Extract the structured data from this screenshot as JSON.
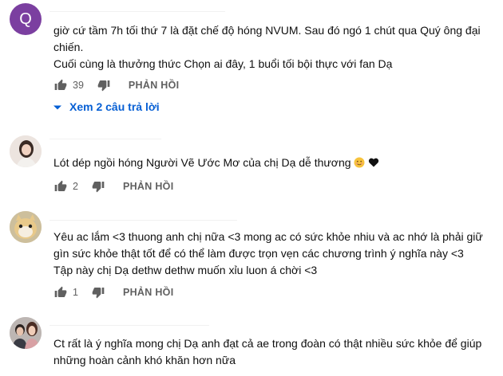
{
  "comments": [
    {
      "avatar_letter": "Q",
      "lines": [
        "giờ cứ tầm 7h tối thứ 7 là đặt chế độ hóng NVUM. Sau đó ngó 1 chút qua Quý ông đại",
        "chiến.",
        "Cuối cùng là thưởng thức Chọn ai đây, 1 buổi tối bội thực với fan Dạ"
      ],
      "likes": "39",
      "reply_label": "PHẢN HỒI",
      "view_replies": "Xem 2 câu trả lời"
    },
    {
      "lines": [
        "Lót dép ngồi hóng Người Vẽ Ước Mơ của chị Dạ dễ thương"
      ],
      "likes": "2",
      "reply_label": "PHẢN HỒI"
    },
    {
      "lines": [
        "Yêu ac lắm <3 thuong anh chị nữa <3 mong ac có sức khỏe nhiu và ac nhớ là phải giữ",
        "gìn sức khỏe thật tốt để có thể làm được trọn vẹn các chương trình ý nghĩa này <3",
        "Tập này chị Dạ dethw dethw muốn xỉu luon á chời <3"
      ],
      "likes": "1",
      "reply_label": "PHẢN HỒI"
    },
    {
      "lines": [
        "Ct rất là ý nghĩa mong chị Dạ anh đạt cả ae trong đoàn có thật nhiều sức khỏe để giúp",
        "những hoàn cảnh khó khăn hơn nữa"
      ]
    }
  ],
  "colors": {
    "text": "#0f0f0f",
    "meta": "#606060",
    "link": "#065fd4",
    "avatar_q": "#7b3fa0"
  }
}
